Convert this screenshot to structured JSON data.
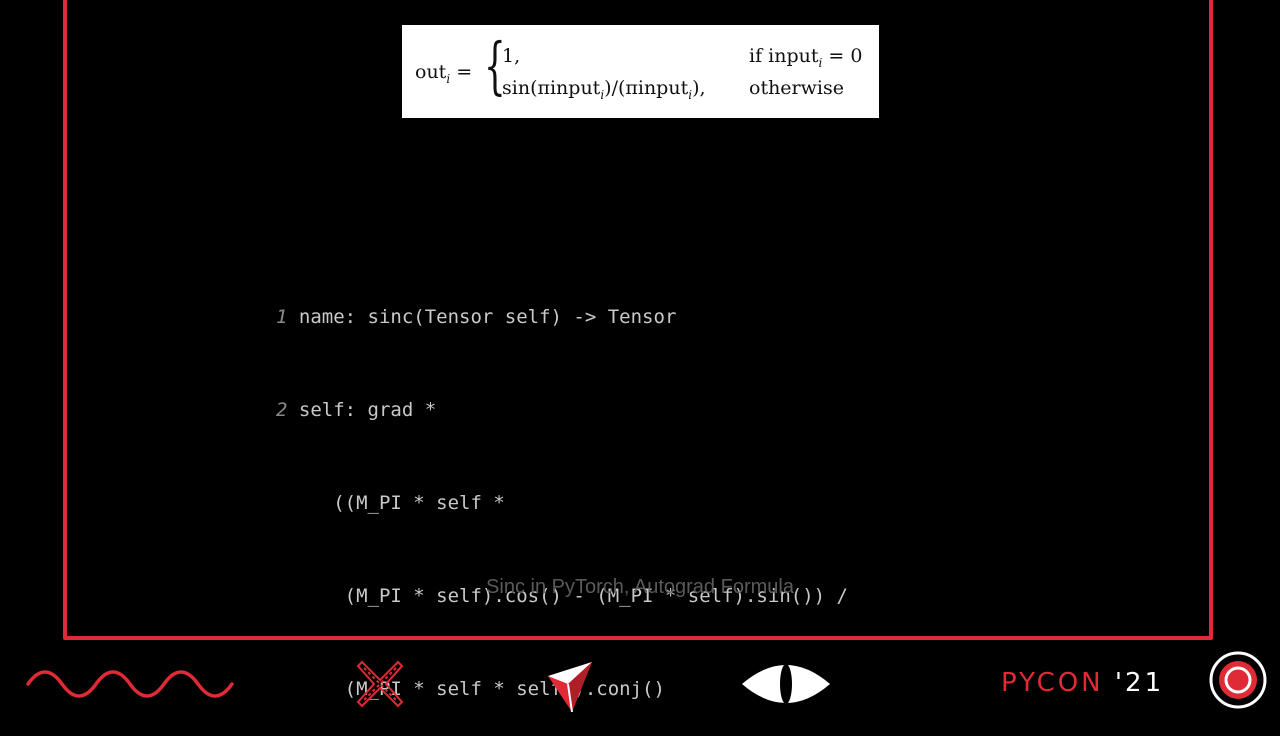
{
  "formula": {
    "lhs": "out",
    "lhs_sub": "i",
    "equals": "=",
    "brace": "{",
    "case1_value": "1,",
    "case1_condition_pre": "if input",
    "case1_condition_sub": "i",
    "case1_condition_post": " = 0",
    "case2_value_pre": "sin(πinput",
    "case2_value_sub1": "i",
    "case2_value_mid": ")/(πinput",
    "case2_value_sub2": "i",
    "case2_value_post": "),",
    "case2_condition": "otherwise"
  },
  "code": {
    "lines": [
      {
        "num": "1",
        "text": " name: sinc(Tensor self) -> Tensor"
      },
      {
        "num": "2",
        "text": " self: grad *"
      },
      {
        "num": "",
        "text": "     ((M_PI * self *"
      },
      {
        "num": "",
        "text": "      (M_PI * self).cos() - (M_PI * self).sin()) /"
      },
      {
        "num": "",
        "text": "      (M_PI * self * self)).conj()"
      }
    ]
  },
  "caption": "Sinc in PyTorch, Autograd Formula",
  "footer": {
    "brand": "PYCON",
    "year": " '21",
    "icons": [
      "wave-icon",
      "x-cross-icon",
      "triangle-logo-icon",
      "eye-icon",
      "target-icon"
    ]
  },
  "colors": {
    "accent": "#e02b36",
    "background": "#000000",
    "code_text": "#c9c9c9",
    "caption_text": "#5a5a5a"
  }
}
